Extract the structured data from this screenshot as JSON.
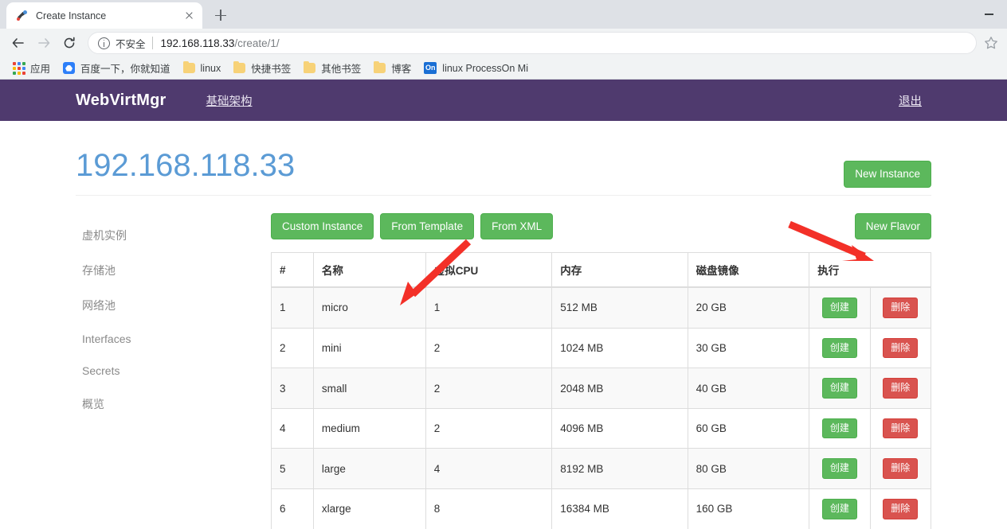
{
  "browser": {
    "tab": {
      "title": "Create Instance",
      "favicon": "webvirtmgr-favicon",
      "close_label": "×"
    },
    "new_tab_label": "+",
    "window": {
      "minimize_label": "—"
    },
    "nav": {
      "back_label": "←",
      "forward_label": "→",
      "reload_label": "⟳"
    },
    "omnibox": {
      "security_label": "不安全",
      "url_host": "192.168.118.33",
      "url_path": "/create/1/"
    },
    "bookmarks": [
      {
        "label": "应用",
        "icon": "apps-grid-icon"
      },
      {
        "label": "百度一下，你就知道",
        "icon": "baidu-icon"
      },
      {
        "label": "linux",
        "icon": "folder-icon"
      },
      {
        "label": "快捷书签",
        "icon": "folder-icon"
      },
      {
        "label": "其他书签",
        "icon": "folder-icon"
      },
      {
        "label": "博客",
        "icon": "folder-icon"
      },
      {
        "label": "linux  ProcessOn Mi",
        "icon": "on-icon"
      }
    ]
  },
  "navbar": {
    "brand": "WebVirtMgr",
    "links": [
      {
        "label": "基础架构"
      }
    ],
    "right_links": [
      {
        "label": "退出"
      }
    ]
  },
  "header": {
    "title": "192.168.118.33",
    "new_instance_label": "New Instance"
  },
  "sidebar": {
    "items": [
      {
        "label": "虚机实例"
      },
      {
        "label": "存储池"
      },
      {
        "label": "网络池"
      },
      {
        "label": "Interfaces"
      },
      {
        "label": "Secrets"
      },
      {
        "label": "概览"
      }
    ]
  },
  "toolbar": {
    "buttons": [
      {
        "label": "Custom Instance"
      },
      {
        "label": "From Template"
      },
      {
        "label": "From XML"
      }
    ],
    "new_flavor_label": "New Flavor"
  },
  "table": {
    "columns": [
      "#",
      "名称",
      "虚拟CPU",
      "内存",
      "磁盘镜像",
      "执行"
    ],
    "action_labels": {
      "create": "创建",
      "delete": "删除"
    },
    "rows": [
      {
        "num": "1",
        "name": "micro",
        "vcpu": "1",
        "memory": "512 MB",
        "disk": "20 GB"
      },
      {
        "num": "2",
        "name": "mini",
        "vcpu": "2",
        "memory": "1024 MB",
        "disk": "30 GB"
      },
      {
        "num": "3",
        "name": "small",
        "vcpu": "2",
        "memory": "2048 MB",
        "disk": "40 GB"
      },
      {
        "num": "4",
        "name": "medium",
        "vcpu": "2",
        "memory": "4096 MB",
        "disk": "60 GB"
      },
      {
        "num": "5",
        "name": "large",
        "vcpu": "4",
        "memory": "8192 MB",
        "disk": "80 GB"
      },
      {
        "num": "6",
        "name": "xlarge",
        "vcpu": "8",
        "memory": "16384 MB",
        "disk": "160 GB"
      }
    ]
  },
  "annotations": [
    {
      "name": "arrow-to-new-instance",
      "color": "#f33028",
      "points_to": "New Instance"
    },
    {
      "name": "arrow-to-custom-instance",
      "color": "#f33028",
      "points_to": "Custom Instance"
    }
  ],
  "colors": {
    "navbar_purple": "#4f3a6e",
    "title_blue": "#5b9bd5",
    "btn_green": "#5cb85c",
    "btn_red": "#d9534f",
    "annotation_red": "#f33028"
  }
}
